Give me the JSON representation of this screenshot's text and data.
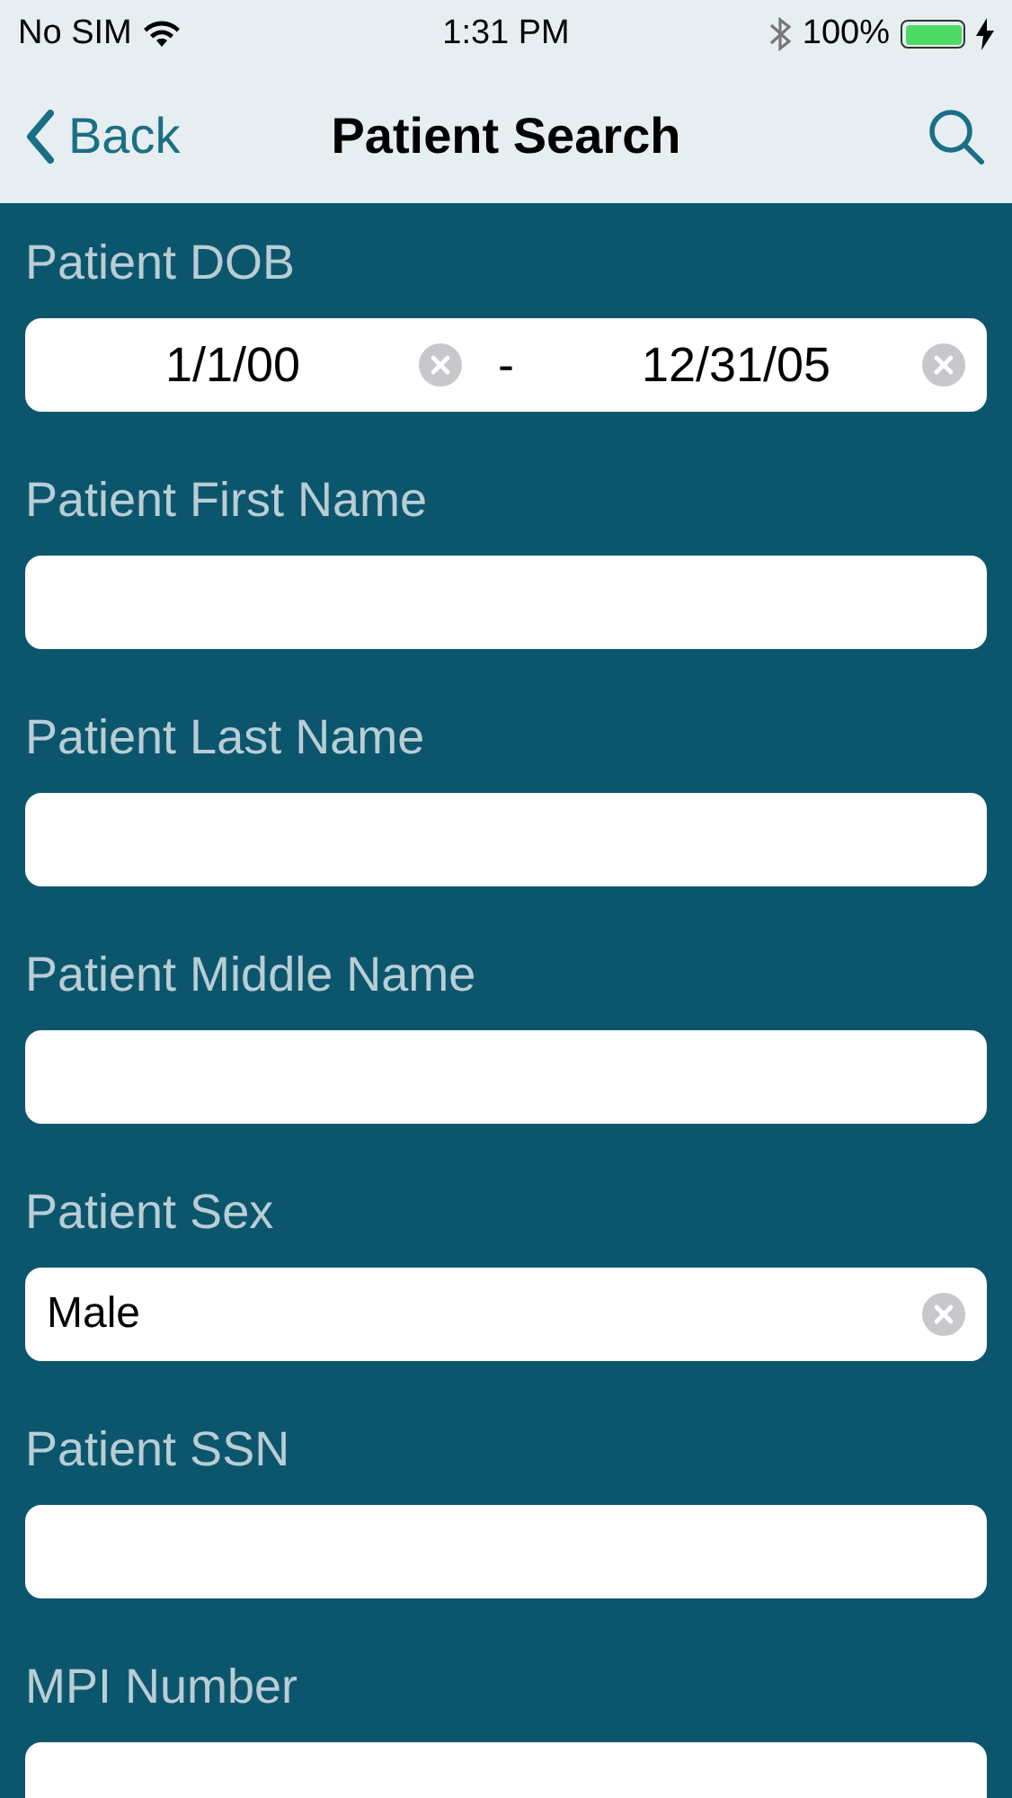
{
  "status_bar": {
    "carrier": "No SIM",
    "time": "1:31 PM",
    "battery": "100%"
  },
  "nav": {
    "back": "Back",
    "title": "Patient Search"
  },
  "fields": [
    {
      "label": "Patient DOB",
      "kind": "range",
      "from": "1/1/00",
      "separator": "-",
      "to": "12/31/05"
    },
    {
      "label": "Patient First Name",
      "kind": "text"
    },
    {
      "label": "Patient Last Name",
      "kind": "text"
    },
    {
      "label": "Patient Middle Name",
      "kind": "text"
    },
    {
      "label": "Patient Sex",
      "kind": "text",
      "value": "Male"
    },
    {
      "label": "Patient SSN",
      "kind": "text"
    },
    {
      "label": "MPI Number",
      "kind": "text"
    }
  ]
}
